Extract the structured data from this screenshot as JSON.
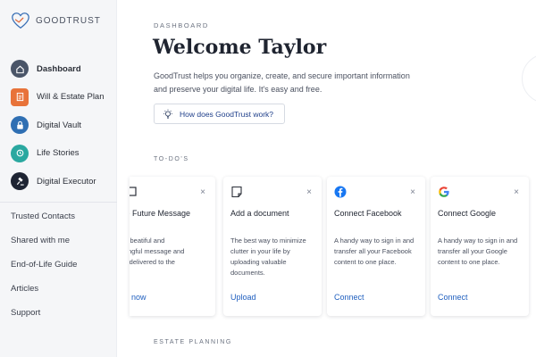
{
  "app": {
    "logo_text": "GOODTRUST"
  },
  "sidebar": {
    "items": [
      {
        "label": "Dashboard",
        "icon": "home-icon",
        "color": "#4a5568",
        "active": true
      },
      {
        "label": "Will & Estate Plan",
        "icon": "document-icon",
        "color": "#e8733a",
        "active": false
      },
      {
        "label": "Digital Vault",
        "icon": "vault-icon",
        "color": "#2f6fb3",
        "active": false
      },
      {
        "label": "Life Stories",
        "icon": "story-icon",
        "color": "#2aa8a0",
        "active": false
      },
      {
        "label": "Digital Executor",
        "icon": "gavel-icon",
        "color": "#1e2433",
        "active": false
      }
    ],
    "links": [
      "Trusted Contacts",
      "Shared with me",
      "End-of-Life Guide",
      "Articles",
      "Support"
    ]
  },
  "main": {
    "eyebrow": "DASHBOARD",
    "title": "Welcome Taylor",
    "intro": "GoodTrust helps you organize, create, and secure important information and preserve your digital life. It's easy and free.",
    "how_button": "How does GoodTrust work?",
    "todos_title": "TO-DO'S",
    "estate_title": "ESTATE PLANNING"
  },
  "cards": [
    {
      "title": "ate Future Message",
      "desc": "ft a beatiful and\naningful message and\ns it delivered to the",
      "action": "rt now",
      "icon": "message-icon"
    },
    {
      "title": "Add a document",
      "desc": "The best way to minimize clutter in your life by uploading valuable documents.",
      "action": "Upload",
      "icon": "note-icon"
    },
    {
      "title": "Connect Facebook",
      "desc": "A handy way to sign in and transfer all your Facebook content to one place.",
      "action": "Connect",
      "icon": "facebook-icon"
    },
    {
      "title": "Connect Google",
      "desc": "A handy way to sign in and transfer all your Google content to one place.",
      "action": "Connect",
      "icon": "google-icon"
    }
  ],
  "close_glyph": "×"
}
